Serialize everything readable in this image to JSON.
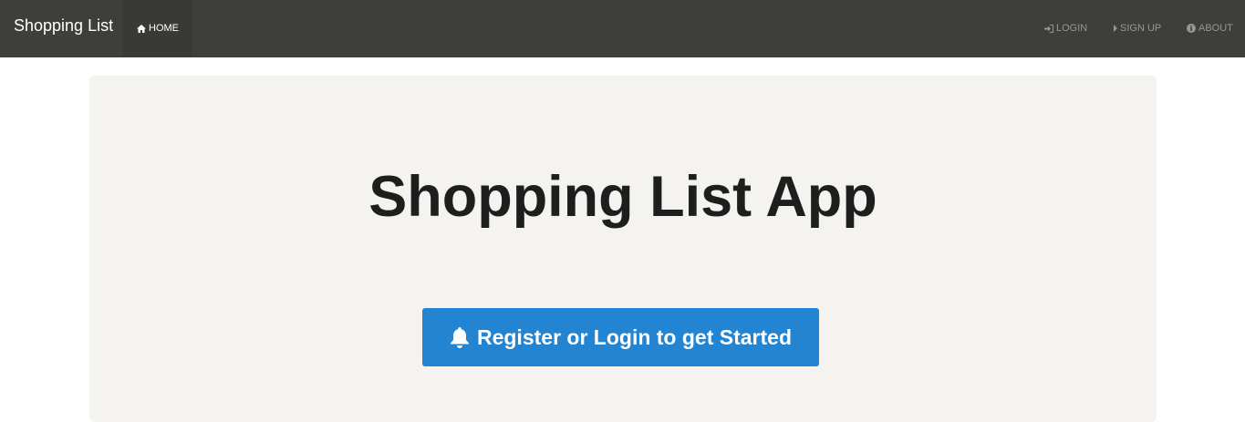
{
  "navbar": {
    "brand": "Shopping List",
    "home_label": "HOME",
    "login_label": "LOGIN",
    "signup_label": "SIGN UP",
    "about_label": "ABOUT",
    "bg_color": "#3e3f3a",
    "text_muted_color": "#98978b",
    "icons": {
      "home": "home-icon",
      "login": "sign-in-icon",
      "signup": "caret-right-icon",
      "about": "info-circle-icon"
    }
  },
  "hero": {
    "title": "Shopping List App",
    "cta_label": "Register or Login to get Started",
    "cta_icon": "bell-icon",
    "cta_color": "#2384d1",
    "bg_color": "#f5f3ef"
  }
}
